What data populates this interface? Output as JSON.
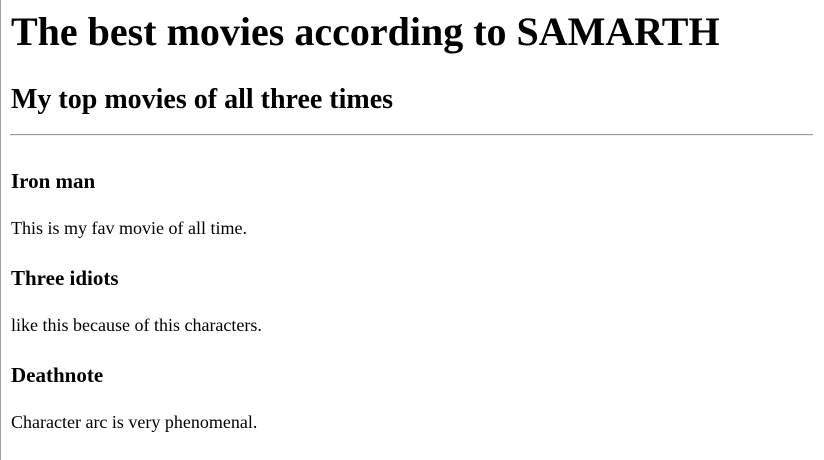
{
  "page": {
    "title": "The best movies according to SAMARTH",
    "subtitle": "My top movies of all three times"
  },
  "movies": [
    {
      "title": "Iron man",
      "description": "This is my fav movie of all time."
    },
    {
      "title": "Three idiots",
      "description": "like this because of this characters."
    },
    {
      "title": "Deathnote",
      "description": "Character arc is very phenomenal."
    }
  ]
}
